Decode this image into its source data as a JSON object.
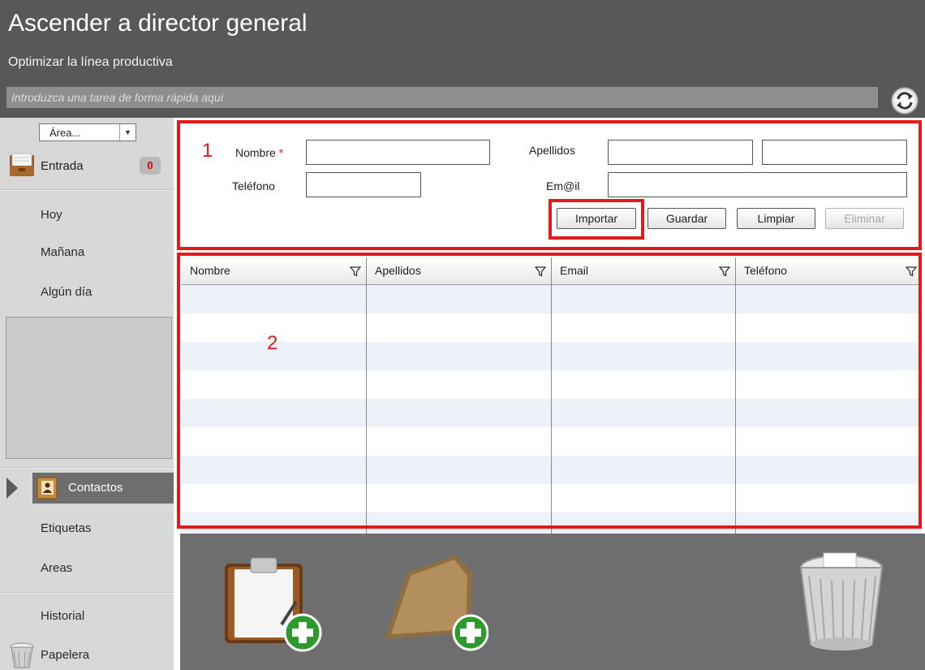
{
  "header": {
    "title": "Ascender a director general",
    "subtitle": "Optimizar la línea productiva",
    "quick_task_placeholder": "Introduzca una tarea de forma rápida aquí"
  },
  "sidebar": {
    "area_select": {
      "selected": "Área..."
    },
    "inbox": {
      "label": "Entrada",
      "count": "0"
    },
    "items": [
      {
        "label": "Hoy"
      },
      {
        "label": "Mañana"
      },
      {
        "label": "Algún día"
      }
    ],
    "contacts": {
      "label": "Contactos"
    },
    "bottom_items": [
      {
        "label": "Etiquetas"
      },
      {
        "label": "Areas"
      },
      {
        "label": "Historial"
      }
    ],
    "trash": {
      "label": "Papelera"
    }
  },
  "form": {
    "annotation": "1",
    "nombre_label": "Nombre",
    "required_mark": "*",
    "apellidos_label": "Apellidos",
    "telefono_label": "Teléfono",
    "email_label": "Em@il",
    "buttons": {
      "importar": "Importar",
      "guardar": "Guardar",
      "limpiar": "Limpiar",
      "eliminar": "Eliminar"
    }
  },
  "grid": {
    "annotation": "2",
    "columns": [
      "Nombre",
      "Apellidos",
      "Email",
      "Teléfono"
    ],
    "rows": []
  },
  "colors": {
    "header_bg": "#585858",
    "sidebar_bg": "#d8d8d8",
    "annotation_red": "#e31a1a",
    "badge_text": "#d40000"
  },
  "icons": {
    "refresh": "refresh-icon",
    "inbox": "inbox-icon",
    "contacts": "contacts-book-icon",
    "trash": "trash-icon",
    "new_task": "clipboard-add-icon",
    "new_folder": "folder-add-icon",
    "recycle_bin": "wastebasket-icon",
    "column_filter": "filter-icon"
  }
}
